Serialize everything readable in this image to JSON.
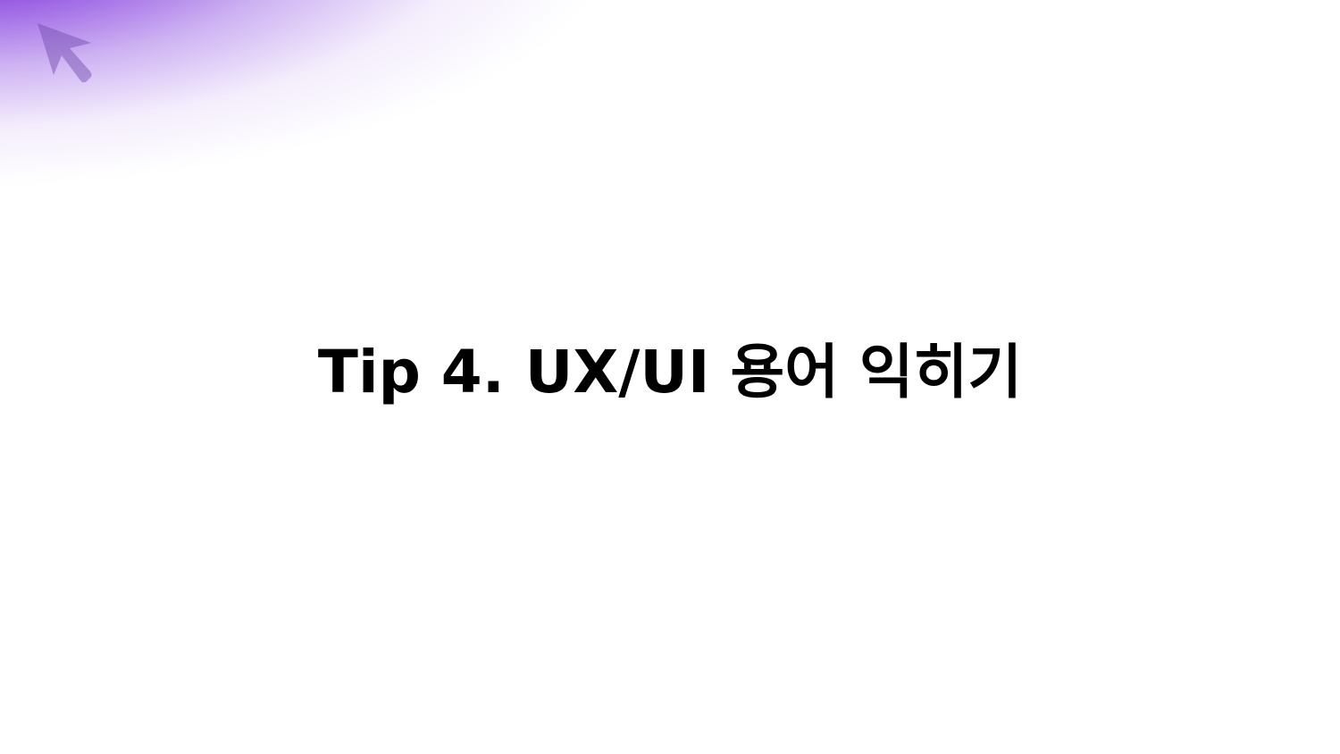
{
  "slide": {
    "title": "Tip 4. UX/UI 용어 익히기"
  },
  "colors": {
    "accent": "#7B2FD6",
    "background": "#FFFFFF",
    "text": "#000000"
  },
  "icons": {
    "cursor": "cursor-arrow-icon"
  }
}
